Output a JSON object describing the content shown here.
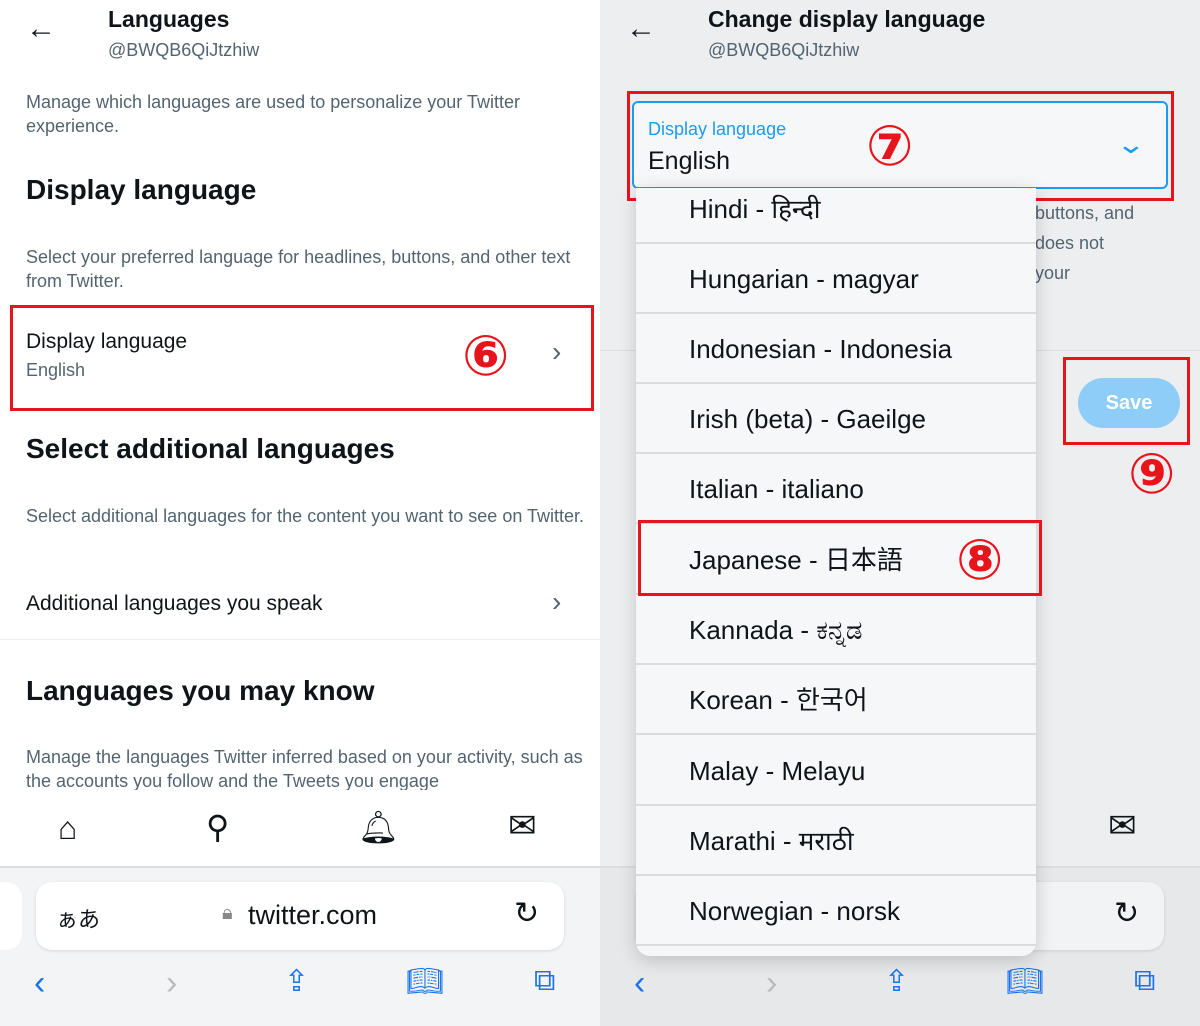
{
  "left": {
    "header": {
      "back_icon": "arrow-left-icon",
      "title": "Languages",
      "handle": "@BWQB6QiJtzhiw"
    },
    "intro": "Manage which languages are used to personalize your Twitter experience.",
    "display_section": {
      "heading": "Display language",
      "description": "Select your preferred language for headlines, buttons, and other text from Twitter.",
      "row_label": "Display language",
      "row_value": "English"
    },
    "additional_section": {
      "heading": "Select additional languages",
      "description": "Select additional languages for the content you want to see on Twitter.",
      "row_label": "Additional languages you speak"
    },
    "may_know_section": {
      "heading": "Languages you may know",
      "description": "Manage the languages Twitter inferred based on your activity, such as the accounts you follow and the Tweets you engage"
    },
    "annotation": "⑥"
  },
  "right": {
    "header": {
      "back_icon": "arrow-left-icon",
      "title": "Change display language",
      "handle": "@BWQB6QiJtzhiw"
    },
    "select": {
      "label": "Display language",
      "value": "English"
    },
    "background_text": [
      "buttons, and",
      "does not",
      "your"
    ],
    "options": [
      "Hindi - हिन्दी",
      "Hungarian - magyar",
      "Indonesian - Indonesia",
      "Irish (beta) - Gaeilge",
      "Italian - italiano",
      "Japanese - 日本語",
      "Kannada - ಕನ್ನಡ",
      "Korean - 한국어",
      "Malay - Melayu",
      "Marathi - मराठी",
      "Norwegian - norsk"
    ],
    "save_label": "Save",
    "annotations": [
      "⑦",
      "⑧",
      "⑨"
    ]
  },
  "browser": {
    "aa": "ぁあ",
    "url": "twitter.com"
  },
  "colors": {
    "accent": "#1d9bf0",
    "annotation": "#e8141b",
    "safari_blue": "#1a73e8"
  }
}
